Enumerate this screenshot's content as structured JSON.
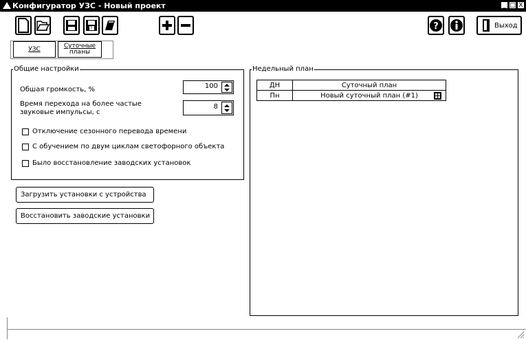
{
  "window": {
    "title": "Конфигуратор УЗС - Новый проект",
    "controls": [
      "_",
      "□",
      "X"
    ]
  },
  "toolbar": {
    "exit_label": "Выход",
    "icons": [
      "new-file-icon",
      "open-folder-icon",
      "save-icon",
      "save-as-icon",
      "erase-icon",
      "plus-icon",
      "minus-icon",
      "help-icon",
      "info-icon",
      "exit-door-icon"
    ]
  },
  "tabs": [
    {
      "label": "УЗС"
    },
    {
      "label_line1": "Суточные",
      "label_line2": "планы"
    }
  ],
  "general": {
    "legend": "Общие настройки",
    "volume_label": "Обшая громкость, %",
    "volume_value": "100",
    "transition_label_line1": "Время перехода на более частые",
    "transition_label_line2": "звуковые импульсы, с",
    "transition_value": "8",
    "checkboxes": [
      {
        "label": "Отключение сезонного перевода времени",
        "checked": false
      },
      {
        "label": "С обучением по двум циклам светофорного объекта",
        "checked": false
      },
      {
        "label": "Было восстановление заводских установок",
        "checked": false
      }
    ]
  },
  "buttons": {
    "load": "Загрузить установки с устройства",
    "restore": "Восстановить заводские установки"
  },
  "weekly": {
    "legend": "Недельный план",
    "headers": [
      "ДН",
      "Суточный план"
    ],
    "rows": [
      {
        "day": "Пн",
        "plan": "Новый суточный план (#1)"
      }
    ]
  }
}
